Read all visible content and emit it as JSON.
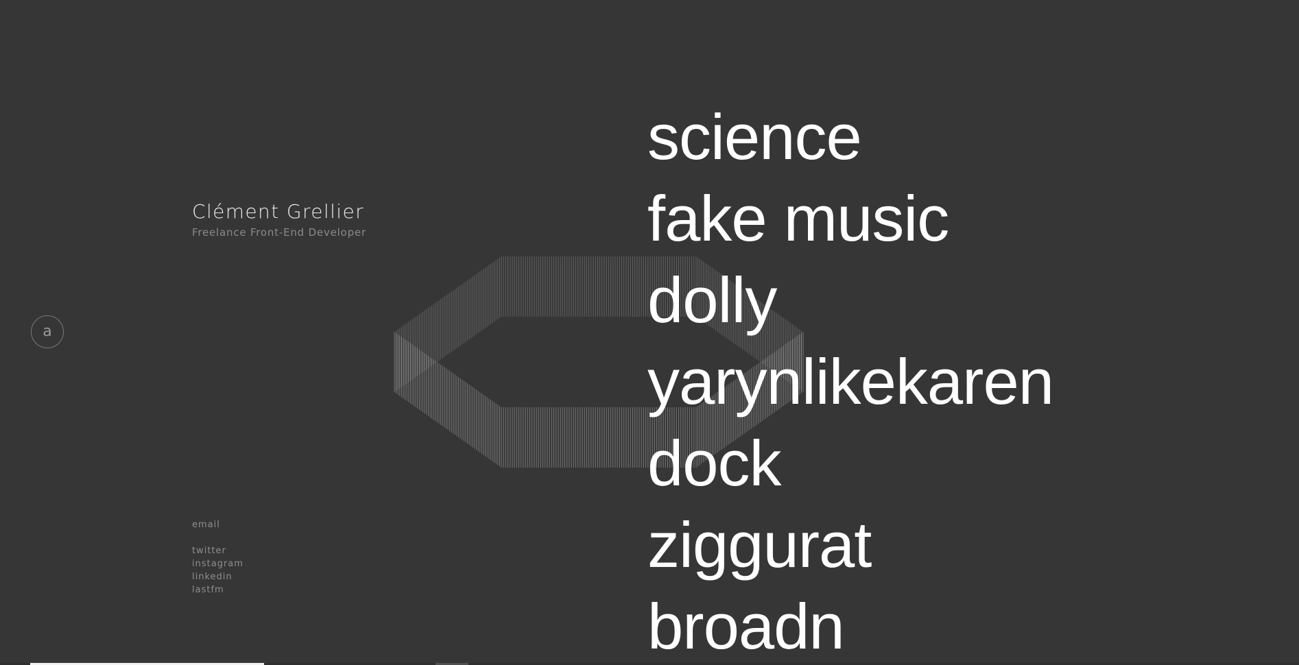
{
  "header": {
    "name": "Clément Grellier",
    "role": "Freelance Front-End Developer"
  },
  "about_button": {
    "label": "a"
  },
  "contact": {
    "email": "email",
    "social": [
      "twitter",
      "instagram",
      "linkedin",
      "lastfm"
    ]
  },
  "projects": [
    "science",
    "fake music",
    "dolly",
    "yarynlikekaren",
    "dock",
    "ziggurat",
    "broadn"
  ],
  "scroll_progress": 0.15,
  "colors": {
    "background": "#363636",
    "text_primary": "#ffffff",
    "text_muted": "#8f8f8f"
  }
}
